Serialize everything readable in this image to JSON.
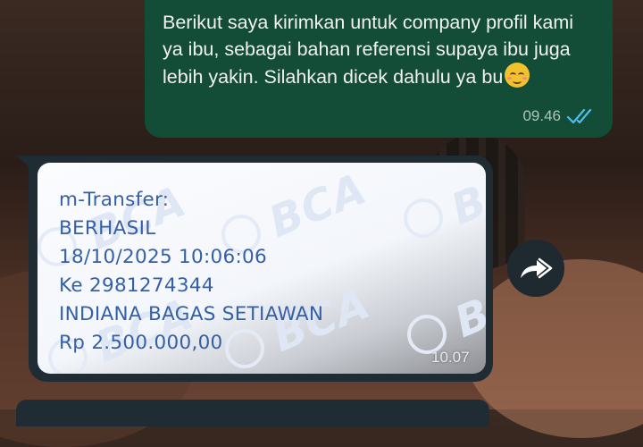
{
  "outgoing_message": {
    "text": "Berikut saya kirimkan untuk company profil kami ya ibu, sebagai bahan referensi supaya ibu juga lebih yakin. Silahkan dicek dahulu ya bu",
    "emoji": "smiling-face-emoji",
    "time": "09.46",
    "status": "read",
    "colors": {
      "bubble": "#144d37",
      "ticks": "#53bdeb"
    }
  },
  "incoming_message": {
    "receipt": {
      "watermark": "BCA",
      "lines": [
        "m-Transfer:",
        "BERHASIL",
        "18/10/2025 10:06:06",
        "Ke 2981274344",
        "INDIANA BAGAS SETIAWAN",
        "Rp 2.500.000,00"
      ],
      "text_color": "#3460a7"
    },
    "time": "10.07",
    "colors": {
      "bubble": "#1f2c34"
    }
  },
  "forward_button": {
    "icon": "forward-icon"
  }
}
